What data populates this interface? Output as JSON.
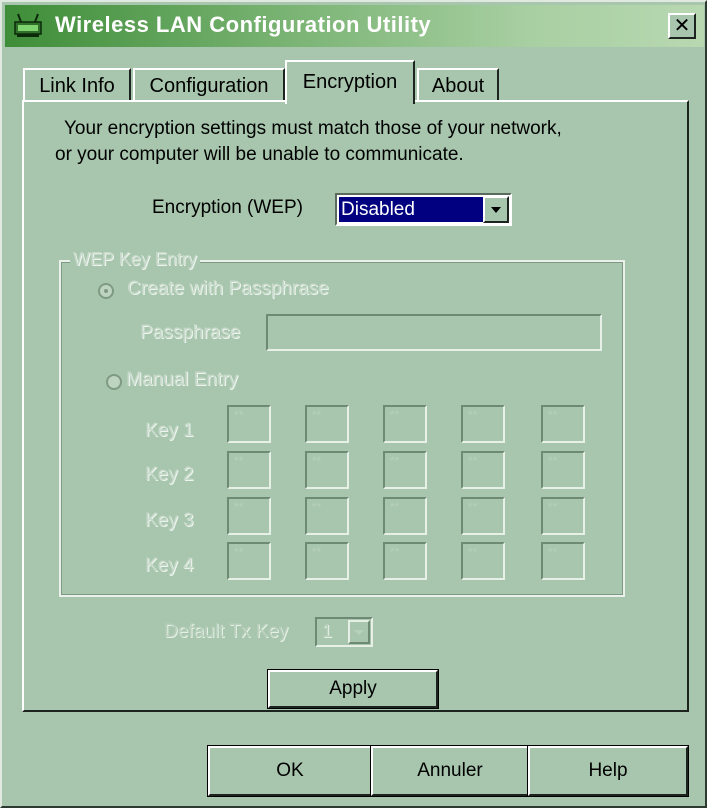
{
  "window": {
    "title": "Wireless LAN Configuration Utility",
    "close_glyph": "✕"
  },
  "tabs": [
    {
      "label": "Link Info"
    },
    {
      "label": "Configuration"
    },
    {
      "label": "Encryption",
      "active": true
    },
    {
      "label": "About"
    }
  ],
  "encryption": {
    "info_line1": "Your encryption settings must match those of your network,",
    "info_line2": "or your computer will be unable to communicate.",
    "wep_label": "Encryption (WEP)",
    "wep_value": "Disabled"
  },
  "wep_key_entry": {
    "group_label": "WEP Key Entry",
    "create_with_passphrase": "Create with Passphrase",
    "passphrase_label": "Passphrase",
    "passphrase_value": "",
    "manual_entry": "Manual Entry",
    "keys": [
      {
        "label": "Key 1",
        "values": [
          "**",
          "**",
          "**",
          "**",
          "**"
        ]
      },
      {
        "label": "Key 2",
        "values": [
          "**",
          "**",
          "**",
          "**",
          "**"
        ]
      },
      {
        "label": "Key 3",
        "values": [
          "**",
          "**",
          "**",
          "**",
          "**"
        ]
      },
      {
        "label": "Key 4",
        "values": [
          "**",
          "**",
          "**",
          "**",
          "**"
        ]
      }
    ]
  },
  "default_tx_key": {
    "label": "Default Tx Key",
    "value": "1"
  },
  "buttons": {
    "apply": "Apply",
    "ok": "OK",
    "cancel": "Annuler",
    "help": "Help"
  },
  "colors": {
    "face": "#a7c6ad",
    "selection": "#000080",
    "title_start": "#3e8d38"
  }
}
